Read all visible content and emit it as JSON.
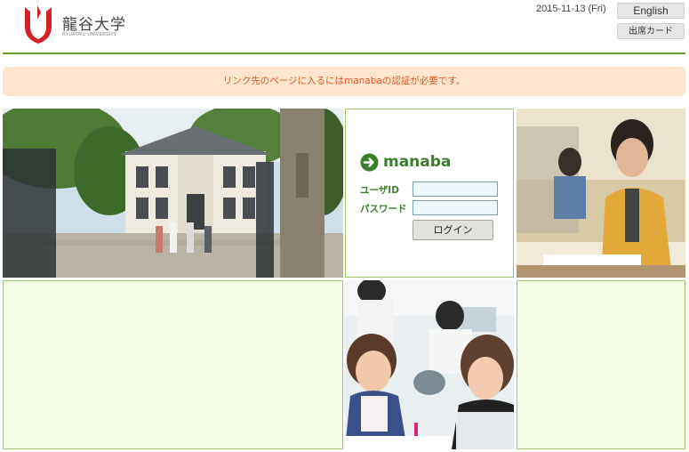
{
  "header": {
    "logo_text": "龍谷大学",
    "logo_subtext": "RYUKOKU UNIVERSITY",
    "date": "2015-11-13 (Fri)",
    "english_button": "English",
    "attendance_card_button": "出席カード"
  },
  "notice": {
    "text": "リンク先のページに入るにはmanabaの認証が必要です。"
  },
  "login": {
    "title": "manaba",
    "user_label": "ユーザID",
    "password_label": "パスワード",
    "user_value": "",
    "password_value": "",
    "submit_label": "ログイン"
  },
  "colors": {
    "accent_green": "#6a9e2a",
    "manaba_green": "#3a7d2c",
    "notice_bg": "#fde6cb",
    "notice_text": "#e0592a",
    "tile_bg": "#f5fde9",
    "logo_red": "#d4222a"
  },
  "icons": {
    "login_arrow": "arrow-right-circle-icon",
    "logo": "ryukoku-logo-mark"
  }
}
